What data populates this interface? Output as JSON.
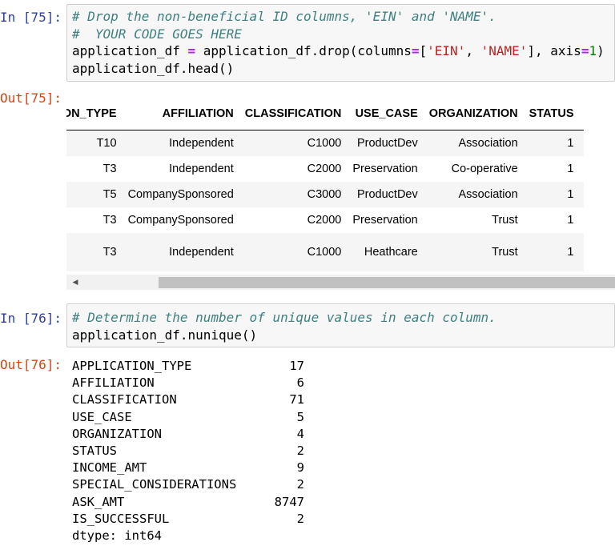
{
  "cells": [
    {
      "in_prompt": "In [75]:",
      "out_prompt": "Out[75]:",
      "code": {
        "line1_comment": "# Drop the non-beneficial ID columns, 'EIN' and 'NAME'.",
        "line2_comment": "#  YOUR CODE GOES HERE",
        "line3_a": "application_df ",
        "line3_eq": "=",
        "line3_b": " application_df.drop(columns",
        "line3_eq2": "=",
        "line3_c": "[",
        "line3_s1": "'EIN'",
        "line3_d": ", ",
        "line3_s2": "'NAME'",
        "line3_e": "], axis",
        "line3_eq3": "=",
        "line3_num": "1",
        "line3_f": ")",
        "line4": "application_df.head()"
      },
      "table": {
        "columns": [
          "TION_TYPE",
          "AFFILIATION",
          "CLASSIFICATION",
          "USE_CASE",
          "ORGANIZATION",
          "STATUS"
        ],
        "rows": [
          [
            "T10",
            "Independent",
            "C1000",
            "ProductDev",
            "Association",
            "1"
          ],
          [
            "T3",
            "Independent",
            "C2000",
            "Preservation",
            "Co-operative",
            "1"
          ],
          [
            "T5",
            "CompanySponsored",
            "C3000",
            "ProductDev",
            "Association",
            "1"
          ],
          [
            "T3",
            "CompanySponsored",
            "C2000",
            "Preservation",
            "Trust",
            "1"
          ],
          [
            "T3",
            "Independent",
            "C1000",
            "Heathcare",
            "Trust",
            "1"
          ]
        ]
      }
    },
    {
      "in_prompt": "In [76]:",
      "out_prompt": "Out[76]:",
      "code": {
        "line1_comment": "# Determine the number of unique values in each column.",
        "line2": "application_df.nunique()"
      },
      "series": [
        {
          "name": "APPLICATION_TYPE",
          "value": "17"
        },
        {
          "name": "AFFILIATION",
          "value": "6"
        },
        {
          "name": "CLASSIFICATION",
          "value": "71"
        },
        {
          "name": "USE_CASE",
          "value": "5"
        },
        {
          "name": "ORGANIZATION",
          "value": "4"
        },
        {
          "name": "STATUS",
          "value": "2"
        },
        {
          "name": "INCOME_AMT",
          "value": "9"
        },
        {
          "name": "SPECIAL_CONSIDERATIONS",
          "value": "2"
        },
        {
          "name": "ASK_AMT",
          "value": "8747"
        },
        {
          "name": "IS_SUCCESSFUL",
          "value": "2"
        }
      ],
      "dtype": "dtype: int64"
    }
  ],
  "colors": {
    "in_prompt": "#303f9f",
    "out_prompt": "#d84315",
    "comment": "#408080",
    "string": "#ba2121",
    "number": "#008000",
    "operator": "#aa22ff"
  }
}
